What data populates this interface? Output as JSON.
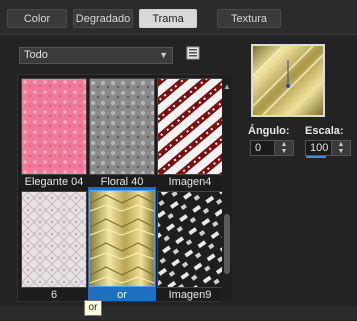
{
  "tabs": [
    {
      "label": "Color"
    },
    {
      "label": "Degradado"
    },
    {
      "label": "Trama",
      "active": true
    },
    {
      "label": "Textura"
    }
  ],
  "category_dropdown": {
    "value": "Todo"
  },
  "patterns": [
    {
      "label": "Elegante 04",
      "icon": "pink-floral-pattern"
    },
    {
      "label": "Floral 40",
      "icon": "gray-floral-pattern"
    },
    {
      "label": "Imagen4",
      "icon": "red-diagonal-stripes-pattern"
    },
    {
      "label": "6",
      "icon": "pale-lace-pattern"
    },
    {
      "label": "or",
      "icon": "gold-pattern",
      "selected": true
    },
    {
      "label": "Imagen9",
      "icon": "black-white-diagonal-pattern"
    }
  ],
  "preview": {
    "icon": "gold-pattern-preview"
  },
  "angle": {
    "label": "Ángulo:",
    "value": "0"
  },
  "scale": {
    "label": "Escala:",
    "value": "100"
  },
  "tooltip": {
    "text": "or"
  },
  "colors": {
    "accent": "#1f6fc0",
    "panel": "#232323",
    "gold": "#d8c77a"
  }
}
